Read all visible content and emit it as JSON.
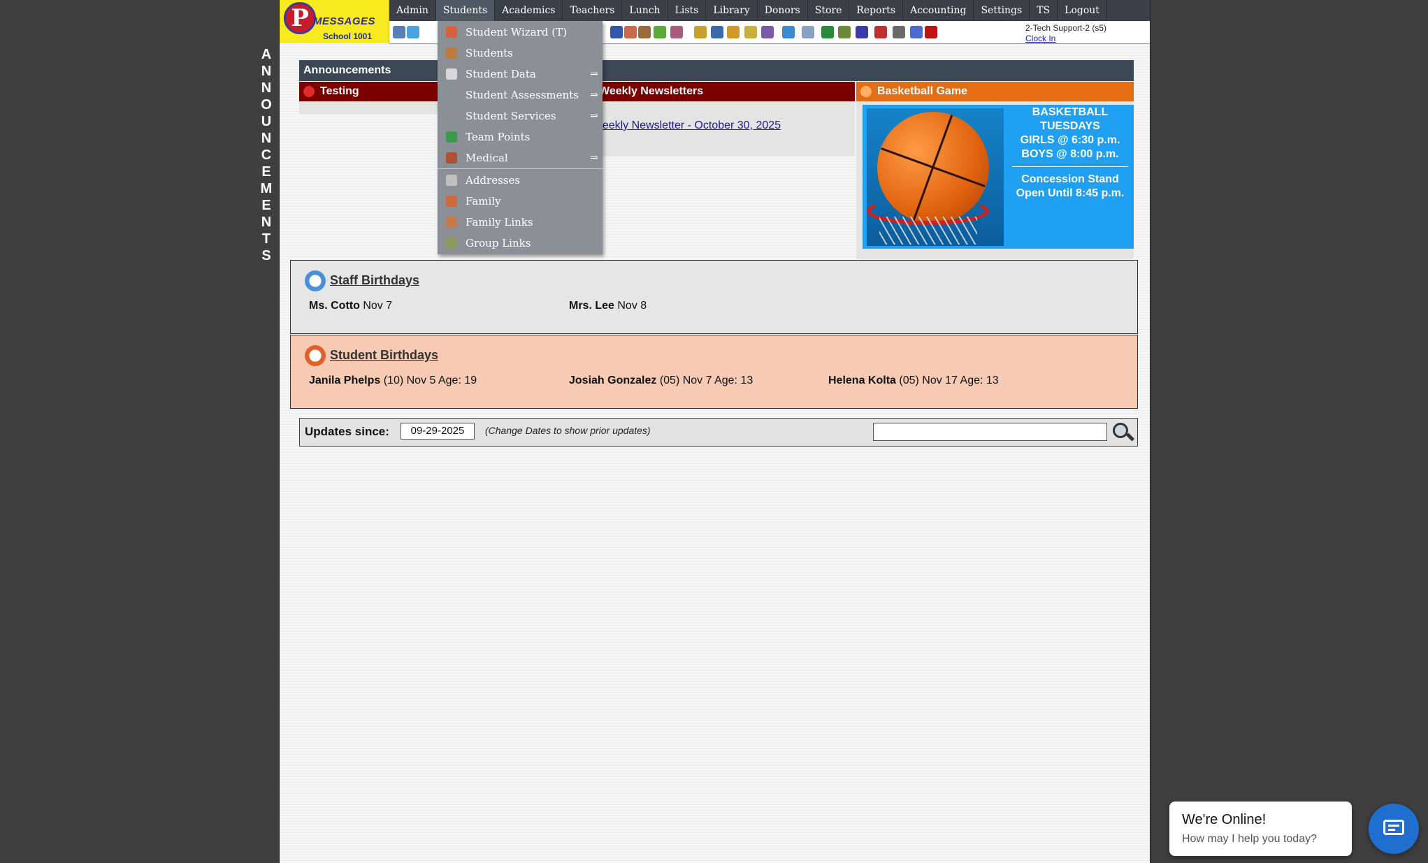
{
  "logo": {
    "letter": "P",
    "brand": "MESSAGES",
    "school": "School 1001"
  },
  "side_text": [
    "A",
    "N",
    "N",
    "O",
    "U",
    "N",
    "C",
    "E",
    "M",
    "E",
    "N",
    "T",
    "S"
  ],
  "menu": [
    "Admin",
    "Students",
    "Academics",
    "Teachers",
    "Lunch",
    "Lists",
    "Library",
    "Donors",
    "Store",
    "Reports",
    "Accounting",
    "Settings",
    "TS",
    "Logout"
  ],
  "menu_active": "Students",
  "user": {
    "name": "2-Tech Support-2 (s5)",
    "clock_in": "Clock In"
  },
  "toolbar_icons": [
    "search-icon",
    "calendar-icon",
    "at-icon",
    "student-icon",
    "student-alt-icon",
    "money-icon",
    "family-icon",
    "lunch-icon",
    "book-icon",
    "broom-icon",
    "mail-icon",
    "teacher-icon",
    "clock-icon",
    "table-icon",
    "ticket-icon",
    "printer-icon",
    "ap-icon",
    "pdf-icon",
    "stack-icon",
    "help-icon",
    "power-icon"
  ],
  "announcements": {
    "title": "Announcements",
    "testing": "Testing",
    "newsletters": "Weekly Newsletters",
    "newsletter_link": "Weekly Newsletter - October 30, 2025",
    "basketball": "Basketball Game",
    "bb_lines": [
      "BASKETBALL",
      "TUESDAYS",
      "GIRLS @ 6:30 p.m.",
      "BOYS  @ 8:00 p.m.",
      "Concession Stand",
      "Open Until 8:45 p.m."
    ]
  },
  "staff_birthdays": {
    "title": "Staff Birthdays",
    "entries": [
      {
        "name": "Ms. Cotto",
        "detail": "Nov 7"
      },
      {
        "name": "Mrs. Lee",
        "detail": "Nov 8"
      }
    ]
  },
  "student_birthdays": {
    "title": "Student Birthdays",
    "entries": [
      {
        "name": "Janila Phelps",
        "detail": "(10) Nov 5 Age: 19"
      },
      {
        "name": "Josiah Gonzalez",
        "detail": "(05) Nov 7 Age: 13"
      },
      {
        "name": "Helena Kolta",
        "detail": "(05) Nov 17 Age: 13"
      }
    ]
  },
  "updates": {
    "label": "Updates since:",
    "date": "09-29-2025",
    "hint": "(Change Dates to show prior updates)",
    "search_value": ""
  },
  "dropdown": [
    {
      "label": "Student Wizard (T)",
      "icon": "wizard-icon",
      "submenu": false
    },
    {
      "label": "Students",
      "icon": "student-icon",
      "submenu": false
    },
    {
      "label": "Student Data",
      "icon": "database-icon",
      "submenu": true
    },
    {
      "label": "Student Assessments",
      "icon": "",
      "submenu": true
    },
    {
      "label": "Student Services",
      "icon": "",
      "submenu": true
    },
    {
      "label": "Team Points",
      "icon": "team-icon",
      "submenu": false
    },
    {
      "label": "Medical",
      "icon": "medical-icon",
      "submenu": true
    },
    {
      "label": "Addresses",
      "icon": "address-card-icon",
      "submenu": false
    },
    {
      "label": "Family",
      "icon": "family-icon",
      "submenu": false
    },
    {
      "label": "Family Links",
      "icon": "family-links-icon",
      "submenu": false
    },
    {
      "label": "Group Links",
      "icon": "group-links-icon",
      "submenu": false
    }
  ],
  "submenu_arrow": "⇒",
  "chat": {
    "title": "We're Online!",
    "subtitle": "How may I help you today?"
  },
  "colors": {
    "menu_bg": "#3a4048",
    "logo_bg": "#f7ea1f",
    "panel_red": "#7b0000",
    "panel_orange": "#e36d12",
    "dropdown_bg": "#8b9097",
    "chat_blue": "#1f6fd0"
  }
}
